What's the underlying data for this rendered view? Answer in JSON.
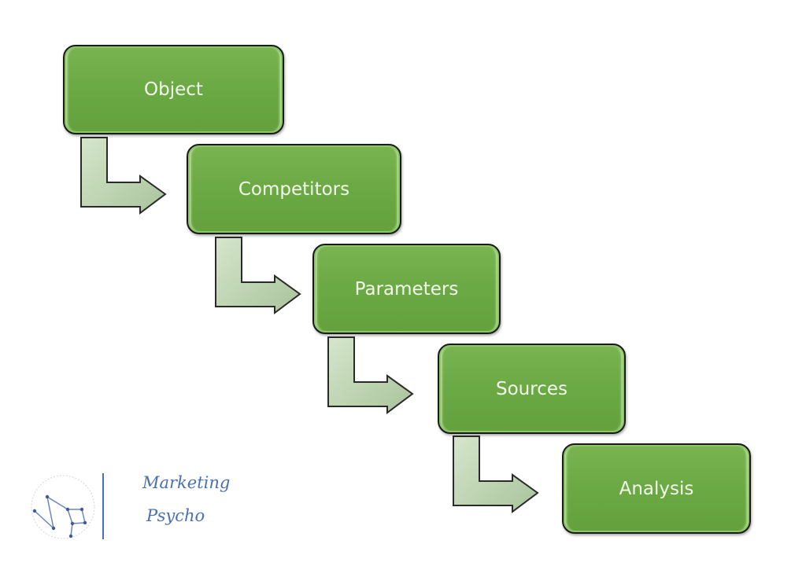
{
  "steps": [
    {
      "label": "Object"
    },
    {
      "label": "Competitors"
    },
    {
      "label": "Parameters"
    },
    {
      "label": "Sources"
    },
    {
      "label": "Analysis"
    }
  ],
  "logo": {
    "line1": "Marketing",
    "line2": "Psycho",
    "color": "#4a6fb5"
  },
  "colors": {
    "box": "#6aa843",
    "box_text": "#f3fbec",
    "arrow": "#c9dcc0",
    "border": "#1a1a1a"
  }
}
